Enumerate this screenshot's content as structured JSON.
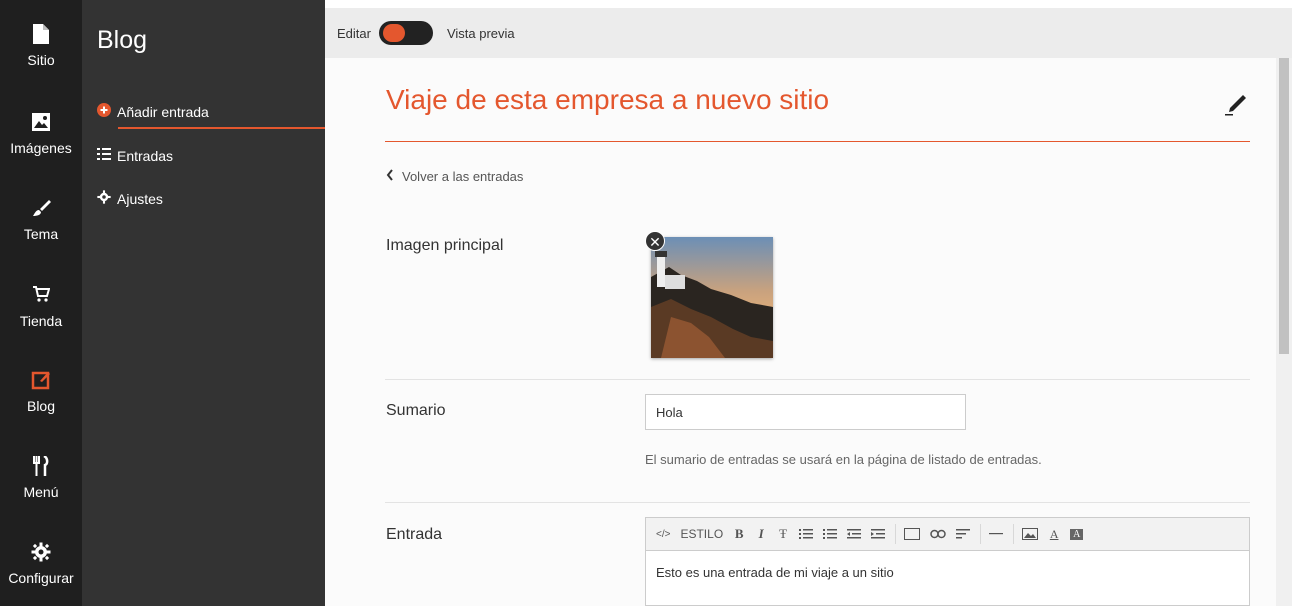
{
  "rail": {
    "items": [
      {
        "label": "Sitio",
        "icon": "file-icon"
      },
      {
        "label": "Imágenes",
        "icon": "image-icon"
      },
      {
        "label": "Tema",
        "icon": "brush-icon"
      },
      {
        "label": "Tienda",
        "icon": "cart-icon"
      },
      {
        "label": "Blog",
        "icon": "edit-square-icon",
        "active": true
      },
      {
        "label": "Menú",
        "icon": "fork-knife-icon"
      },
      {
        "label": "Configurar",
        "icon": "gear-icon"
      }
    ]
  },
  "sidebar": {
    "title": "Blog",
    "items": [
      {
        "label": "Añadir entrada",
        "icon": "plus-circle-icon"
      },
      {
        "label": "Entradas",
        "icon": "list-icon"
      },
      {
        "label": "Ajustes",
        "icon": "gear-icon"
      }
    ]
  },
  "topbar": {
    "edit_label": "Editar",
    "preview_label": "Vista previa"
  },
  "post": {
    "title": "Viaje de esta empresa a nuevo sitio",
    "back_label": "Volver a las entradas",
    "image_label": "Imagen principal",
    "summary_label": "Sumario",
    "summary_value": "Hola",
    "summary_help": "El sumario de entradas se usará en la página de listado de entradas.",
    "entry_label": "Entrada",
    "entry_text": "Esto es una entrada de mi viaje a un sitio"
  },
  "editor_toolbar": {
    "source": "</>",
    "style": "ESTILO",
    "bold": "B",
    "italic": "I",
    "strike": "Ŧ",
    "underline": "A",
    "highlight": "A"
  },
  "colors": {
    "accent": "#e4572e",
    "rail_bg": "#1f1f1f",
    "sidebar_bg": "#333333"
  }
}
